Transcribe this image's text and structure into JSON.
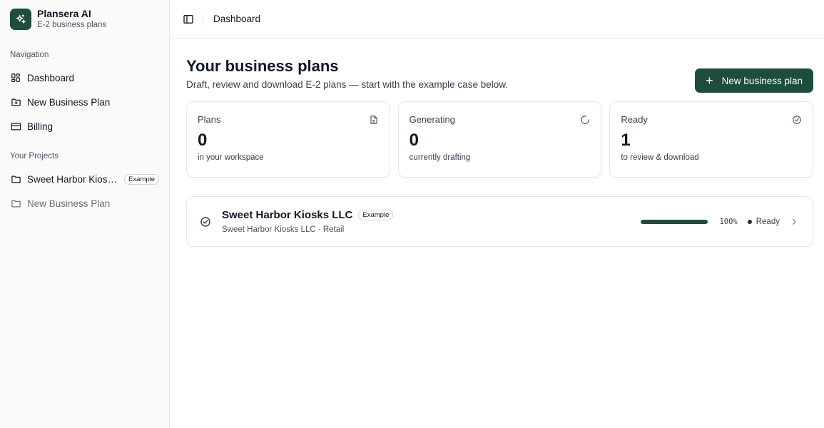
{
  "brand": {
    "title": "Plansera AI",
    "subtitle": "E-2 business plans",
    "icon": "sparkles-icon",
    "color": "#1f4d3d"
  },
  "sidebar": {
    "navigation_label": "Navigation",
    "nav_items": [
      {
        "label": "Dashboard",
        "icon": "dashboard-icon"
      },
      {
        "label": "New Business Plan",
        "icon": "folder-plus-icon"
      },
      {
        "label": "Billing",
        "icon": "credit-card-icon"
      }
    ],
    "projects_label": "Your Projects",
    "projects": [
      {
        "label": "Sweet Harbor Kiosks LLC",
        "badge": "Example",
        "icon": "folder-icon"
      },
      {
        "label": "New Business Plan",
        "icon": "folder-icon"
      }
    ]
  },
  "topbar": {
    "breadcrumb": "Dashboard",
    "toggle_icon": "sidebar-toggle-icon"
  },
  "page": {
    "title": "Your business plans",
    "subtitle": "Draft, review and download E-2 plans — start with the example case below.",
    "new_button_label": "New business plan",
    "new_button_icon": "+"
  },
  "stats": [
    {
      "label": "Plans",
      "value": "0",
      "note": "in your workspace",
      "icon": "document-icon"
    },
    {
      "label": "Generating",
      "value": "0",
      "note": "currently drafting",
      "icon": "spinner-icon"
    },
    {
      "label": "Ready",
      "value": "1",
      "note": "to review & download",
      "icon": "check-circle-icon"
    }
  ],
  "plans": [
    {
      "title": "Sweet Harbor Kiosks LLC",
      "badge": "Example",
      "meta": "Sweet Harbor Kiosks LLC · Retail",
      "progress": 100,
      "progress_label": "100%",
      "status": "Ready"
    }
  ]
}
